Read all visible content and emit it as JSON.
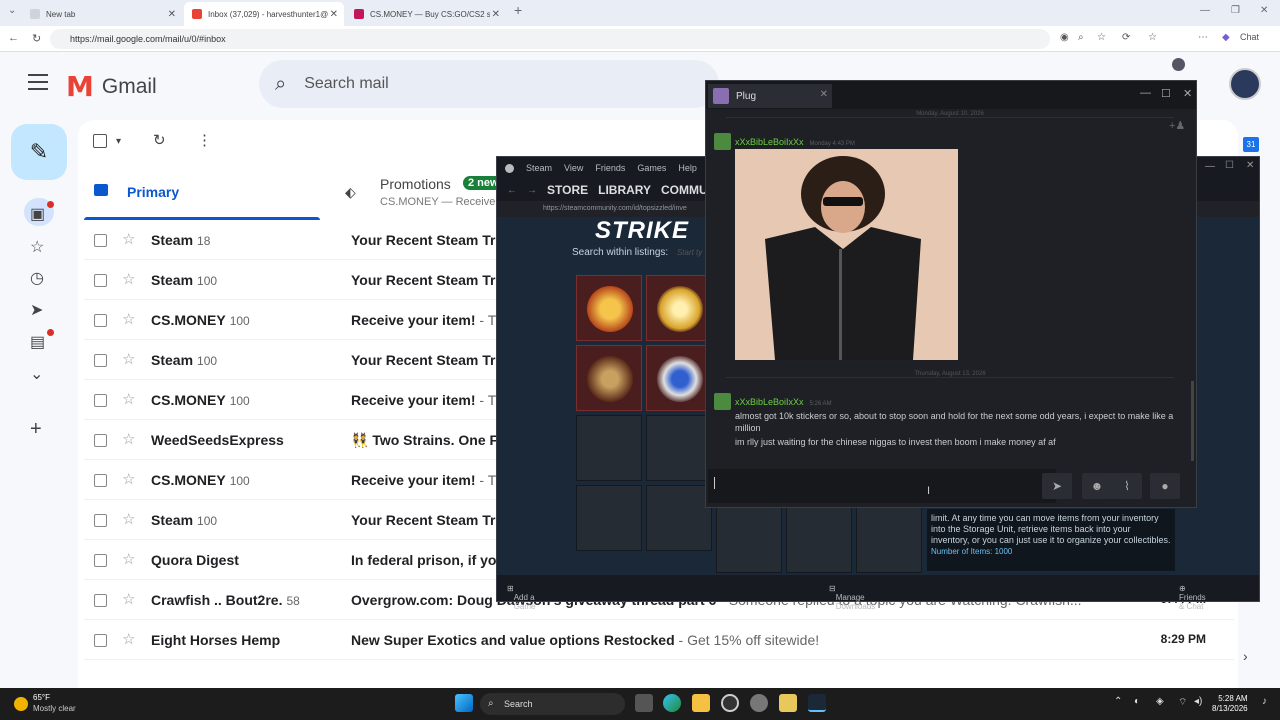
{
  "browser": {
    "tabs": [
      {
        "label": "New tab",
        "active": false
      },
      {
        "label": "Inbox (37,029) - harvesthunter1@",
        "active": true
      },
      {
        "label": "CS.MONEY — Buy CS:GO/CS2 skin",
        "active": false
      }
    ],
    "url": "https://mail.google.com/mail/u/0/#inbox",
    "chat_label": "Chat"
  },
  "gmail": {
    "logo_text": "Gmail",
    "search_placeholder": "Search mail",
    "tabs": {
      "primary": "Primary",
      "promotions": "Promotions",
      "promotions_badge": "2 new",
      "promotions_sub": "CS.MONEY — Receive"
    },
    "rows": [
      {
        "sender": "Steam",
        "count": "18",
        "subject": "Your Recent Steam Tr",
        "snippet": "",
        "time": ""
      },
      {
        "sender": "Steam",
        "count": "100",
        "subject": "Your Recent Steam Tr",
        "snippet": "",
        "time": ""
      },
      {
        "sender": "CS.MONEY",
        "count": "100",
        "subject": "Receive your item!",
        "snippet": " - T",
        "time": ""
      },
      {
        "sender": "Steam",
        "count": "100",
        "subject": "Your Recent Steam Tr",
        "snippet": "",
        "time": ""
      },
      {
        "sender": "CS.MONEY",
        "count": "100",
        "subject": "Receive your item!",
        "snippet": " - T",
        "time": ""
      },
      {
        "sender": "WeedSeedsExpress",
        "count": "",
        "subject": "👯 Two Strains. One F",
        "snippet": "",
        "time": ""
      },
      {
        "sender": "CS.MONEY",
        "count": "100",
        "subject": "Receive your item!",
        "snippet": " - T",
        "time": ""
      },
      {
        "sender": "Steam",
        "count": "100",
        "subject": "Your Recent Steam Tr",
        "snippet": "",
        "time": ""
      },
      {
        "sender": "Quora Digest",
        "count": "",
        "subject": "In federal prison, if yo",
        "snippet": "",
        "time": ""
      },
      {
        "sender": "Crawfish .. Bout2re.",
        "count": "58",
        "subject": "Overgrow.com: Doug Dawson's giveaway thread part 6",
        "snippet": " - Someone replied to a topic you are Watching. Crawfish...",
        "time": "9:44 PM"
      },
      {
        "sender": "Eight Horses Hemp",
        "count": "",
        "subject": "New Super Exotics and value options Restocked",
        "snippet": " - Get 15% off sitewide!",
        "time": "8:29 PM"
      }
    ]
  },
  "steam": {
    "menu": [
      "Steam",
      "View",
      "Friends",
      "Games",
      "Help"
    ],
    "nav": [
      "STORE",
      "LIBRARY",
      "COMMU"
    ],
    "url": "https://steamcommunity.com/id/topsizzled/inve",
    "banner": "STRIKE",
    "search_label": "Search within listings:",
    "search_placeholder": "Start ty",
    "storage_text": "limit. At any time you can move items from your inventory into the Storage Unit, retrieve items back into your inventory, or you can just use it to organize your collectibles.",
    "storage_count": "Number of Items: 1000",
    "footer": {
      "add_game": "Add a Game",
      "manage_downloads": "Manage Downloads",
      "friends_chat": "Friends & Chat"
    }
  },
  "chat": {
    "tab_name": "Plug",
    "date1": "Monday, August 10, 2026",
    "date2": "Thursday, August 13, 2026",
    "msg1": {
      "name": "xXxBibLeBoiIxXx",
      "time": "Monday 4:43 PM"
    },
    "msg2": {
      "name": "xXxBibLeBoiIxXx",
      "time": "5:26 AM",
      "line1": "almost got 10k stickers or so, about to stop soon and hold for the next some odd years, i expect to make like a million",
      "line2": "im rlly just waiting for the chinese niggas to invest then boom i make money af af"
    }
  },
  "taskbar": {
    "temp": "65°F",
    "weather": "Mostly clear",
    "search": "Search",
    "time": "5:28 AM",
    "date": "8/13/2026"
  }
}
